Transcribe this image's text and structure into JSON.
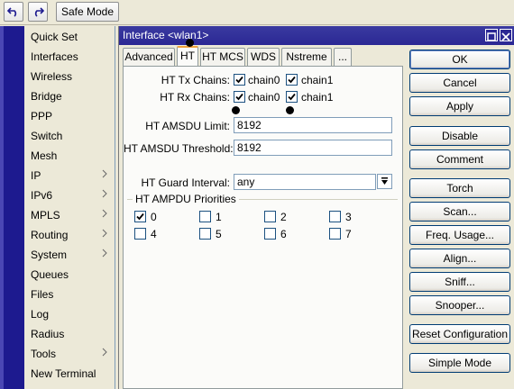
{
  "toolbar": {
    "undo_icon": "undo-icon",
    "redo_icon": "redo-icon",
    "safe_mode_label": "Safe Mode"
  },
  "sidebar": {
    "items": [
      {
        "label": "Quick Set",
        "submenu": false
      },
      {
        "label": "Interfaces",
        "submenu": false
      },
      {
        "label": "Wireless",
        "submenu": false
      },
      {
        "label": "Bridge",
        "submenu": false
      },
      {
        "label": "PPP",
        "submenu": false
      },
      {
        "label": "Switch",
        "submenu": false
      },
      {
        "label": "Mesh",
        "submenu": false
      },
      {
        "label": "IP",
        "submenu": true
      },
      {
        "label": "IPv6",
        "submenu": true
      },
      {
        "label": "MPLS",
        "submenu": true
      },
      {
        "label": "Routing",
        "submenu": true
      },
      {
        "label": "System",
        "submenu": true
      },
      {
        "label": "Queues",
        "submenu": false
      },
      {
        "label": "Files",
        "submenu": false
      },
      {
        "label": "Log",
        "submenu": false
      },
      {
        "label": "Radius",
        "submenu": false
      },
      {
        "label": "Tools",
        "submenu": true
      },
      {
        "label": "New Terminal",
        "submenu": false
      }
    ]
  },
  "dialog": {
    "title": "Interface <wlan1>",
    "tabs": [
      "Advanced",
      "HT",
      "HT MCS",
      "WDS",
      "Nstreme",
      "..."
    ],
    "active_tab": "HT",
    "ht_tx_chains_label": "HT Tx Chains:",
    "ht_rx_chains_label": "HT Rx Chains:",
    "tx_chain0": {
      "label": "chain0",
      "checked": true
    },
    "tx_chain1": {
      "label": "chain1",
      "checked": true
    },
    "rx_chain0": {
      "label": "chain0",
      "checked": true
    },
    "rx_chain1": {
      "label": "chain1",
      "checked": true
    },
    "amsdu_limit_label": "HT AMSDU Limit:",
    "amsdu_limit_value": "8192",
    "amsdu_threshold_label": "HT AMSDU Threshold:",
    "amsdu_threshold_value": "8192",
    "guard_interval_label": "HT Guard Interval:",
    "guard_interval_value": "any",
    "ampdu_group_title": "HT AMPDU Priorities",
    "ampdu_priorities": [
      {
        "label": "0",
        "checked": true
      },
      {
        "label": "1",
        "checked": false
      },
      {
        "label": "2",
        "checked": false
      },
      {
        "label": "3",
        "checked": false
      },
      {
        "label": "4",
        "checked": false
      },
      {
        "label": "5",
        "checked": false
      },
      {
        "label": "6",
        "checked": false
      },
      {
        "label": "7",
        "checked": false
      }
    ]
  },
  "buttons": {
    "ok": "OK",
    "cancel": "Cancel",
    "apply": "Apply",
    "disable": "Disable",
    "comment": "Comment",
    "torch": "Torch",
    "scan": "Scan...",
    "freq_usage": "Freq. Usage...",
    "align": "Align...",
    "sniff": "Sniff...",
    "snooper": "Snooper...",
    "reset_configuration": "Reset Configuration",
    "simple_mode": "Simple Mode"
  }
}
